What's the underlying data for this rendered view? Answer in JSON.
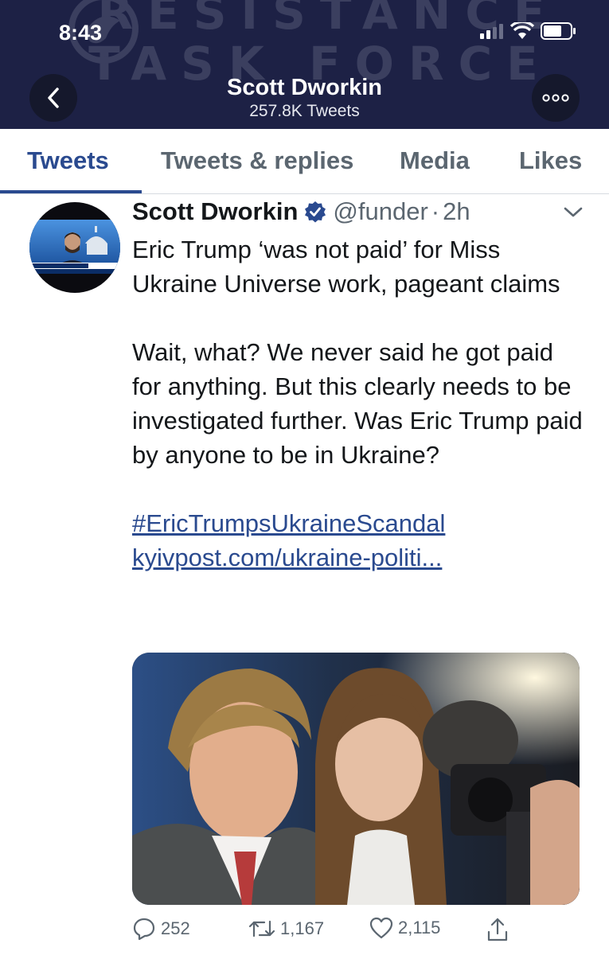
{
  "status_bar": {
    "time": "8:43"
  },
  "header": {
    "banner_line1": "RESISTANCE",
    "banner_line2": "TASK FORCE",
    "title": "Scott Dworkin",
    "subtitle": "257.8K Tweets"
  },
  "tabs": [
    {
      "label": "Tweets",
      "active": true
    },
    {
      "label": "Tweets & replies",
      "active": false
    },
    {
      "label": "Media",
      "active": false
    },
    {
      "label": "Likes",
      "active": false
    }
  ],
  "tweet": {
    "name": "Scott Dworkin",
    "handle": "@funder",
    "dot": "·",
    "time": "2h",
    "text_1": "Eric Trump ‘was not paid’ for Miss Ukraine Universe work, pageant claims",
    "text_2": "Wait, what? We never said he got paid for anything. But this clearly needs to be investigated further. Was Eric Trump paid by anyone to be in Ukraine?",
    "hashtag": "#EricTrumpsUkraineScandal",
    "link": "kyivpost.com/ukraine-politi...",
    "replies": "252",
    "retweets": "1,167",
    "likes": "2,115"
  },
  "colors": {
    "header_bg": "#1d2145",
    "accent": "#2a4a8f",
    "muted": "#5b6670"
  }
}
